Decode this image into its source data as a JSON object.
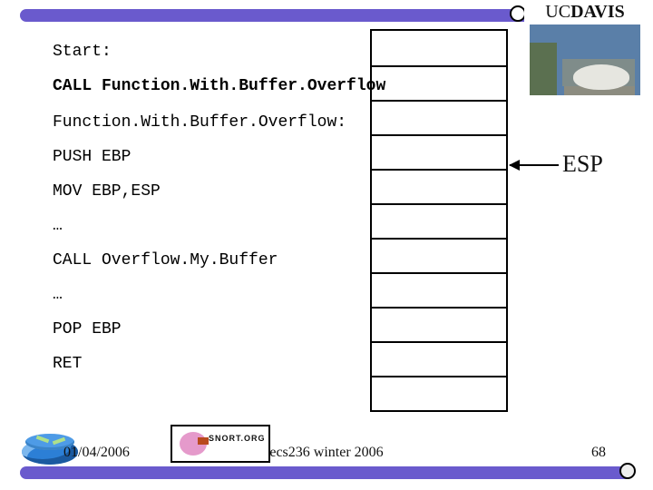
{
  "brand": {
    "uc": "UC",
    "davis": "DAVIS"
  },
  "code_lines": [
    {
      "text": "Start:",
      "bold": false
    },
    {
      "text": "CALL Function.With.Buffer.Overflow",
      "bold": true
    },
    {
      "text": "Function.With.Buffer.Overflow:",
      "bold": false
    },
    {
      "text": "PUSH EBP",
      "bold": false
    },
    {
      "text": "MOV EBP,ESP",
      "bold": false
    },
    {
      "text": "…",
      "bold": false
    },
    {
      "text": "CALL Overflow.My.Buffer",
      "bold": false
    },
    {
      "text": "…",
      "bold": false
    },
    {
      "text": "POP EBP",
      "bold": false
    },
    {
      "text": "RET",
      "bold": false
    }
  ],
  "stack_cells": 11,
  "pointer_label": "ESP",
  "snort_label": "SNORT.ORG",
  "footer": {
    "date": "01/04/2006",
    "center": "ecs236 winter 2006",
    "page": "68"
  }
}
